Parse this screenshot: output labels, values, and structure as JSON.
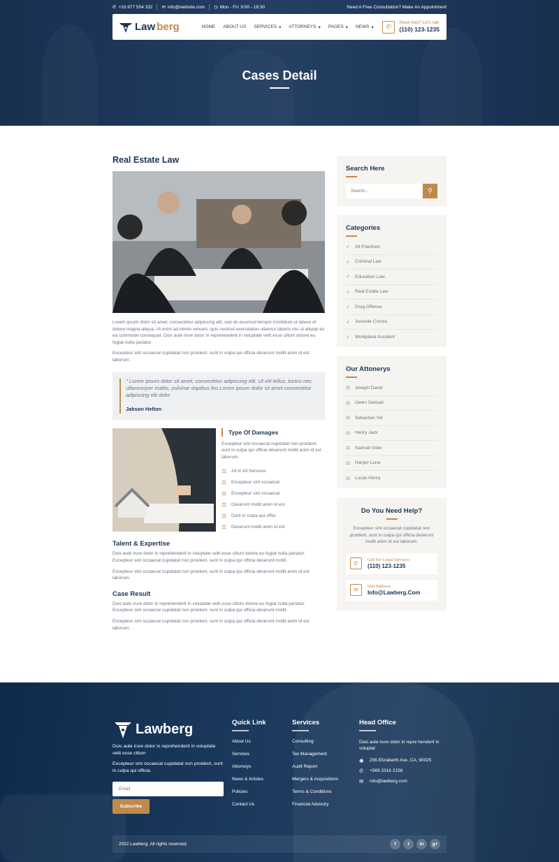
{
  "topbar": {
    "phone": "+33 877 554 332",
    "email": "info@website.com",
    "hours": "Mon - Fri: 9:00 - 18:30",
    "cta": "Need A Free Consultation? Make An Appointment"
  },
  "brand": {
    "name_a": "Law",
    "name_b": "berg",
    "full": "Lawberg"
  },
  "nav": {
    "items": [
      "HOME",
      "ABOUT US",
      "SERVICES",
      "ATTORNEYS",
      "PAGES",
      "NEWS"
    ],
    "help_label": "Need Help? Let's talk",
    "help_phone": "(110) 123-1235"
  },
  "hero": {
    "title": "Cases Detail"
  },
  "article": {
    "title": "Real Estate Law",
    "para1": "Lorem ipsum dolor sit amet, consectetur adipiscing elit, sed do eiusmod tempor incididunt ut labore et dolore magna aliqua. Ut enim ad minim veniam, quis nostrud exercitation ullamco laboris nisi ut aliquip ex ea commodo consequat. Duis aute irure dolor in reprehenderit in voluptate velit esse cillum dolore eu fugiat nulla pariatur.",
    "para2": "Excepteur sint occaecat cupidatat non proident, sunt in culpa qui officia deserunt mollit anim id est laborum.",
    "quote": "\" Lorem ipsum dolor sit amet, consectetur adipiscing elit. Ut elit tellus, luctus nec ullamcorper mattis, pulvinar dapibus leo.Lorem ipsum dolor sit amet consectetur adipiscing elit dolor",
    "quote_author": "Jakson Helton",
    "damages_title": "Type Of Damages",
    "damages_desc": "Excepteur sint occaecat cupidatat non proident, sunt in culpa qui officia deserunt mollit anim id est laborum.",
    "damages_list": [
      "All In All Services",
      "Excepteur sint occaecat",
      "Excepteur sint occaecat",
      "Deserunt mollit anim id est",
      "Dunt in culpa qui offici",
      "Deserunt mollit anim id est"
    ],
    "talent_title": "Talent & Expertise",
    "talent_p1": "Duis aute irure dolor in reprehenderit in voluptate velit esse cillum dolore eu fugiat nulla pariatur. Excepteur sint occaecat cupidatat non proident, sunt in culpa qui officia deserunt mollit.",
    "talent_p2": "Excepteur sint occaecat cupidatat non proident, sunt in culpa qui officia deserunt mollit anim id est laborum.",
    "result_title": "Case Result",
    "result_p1": "Duis aute irure dolor in reprehenderit in voluptate velit esse cillum dolore eu fugiat nulla pariatur. Excepteur sint occaecat cupidatat non proident, sunt in culpa qui officia deserunt mollit.",
    "result_p2": "Excepteur sint occaecat cupidatat non proident, sunt in culpa qui officia deserunt mollit anim id est laborum."
  },
  "sidebar": {
    "search_title": "Search Here",
    "search_placeholder": "Search...",
    "categories_title": "Categories",
    "categories": [
      "All Practises",
      "Criminal Law",
      "Education Law",
      "Real Estate Law",
      "Drug Offense",
      "Juvenile Crimes",
      "Workplace Accident"
    ],
    "attorneys_title": "Our Attonerys",
    "attorneys": [
      "Joseph David",
      "Owen Samuel",
      "Sebastian Vol",
      "Henry Jack",
      "Samuel Voler",
      "Harper Luna",
      "Lucas Henry"
    ],
    "help_title": "Do You Need Help?",
    "help_desc": "Excepteur sint occaecat cupidatat non proident, sunt in culpa qui officia deserunt mollit anim id est laborum.",
    "call_label": "Call For Legal Services",
    "call_value": "(110) 123-1235",
    "mail_label": "Mail Address",
    "mail_value": "Info@Lawberg.Com"
  },
  "footer": {
    "about1": "Duis aute irure dolor in reprehenderit in voluptate velit esse cillum",
    "about2": "Excepteur sint occaecat cupidatat non proident, sunt in culpa qui officia.",
    "email_placeholder": "Email",
    "subscribe": "Subscribe",
    "quick_title": "Quick Link",
    "quick": [
      "About Us",
      "Services",
      "Attorneys",
      "News & Articles",
      "Policies",
      "Contact Us"
    ],
    "services_title": "Services",
    "services": [
      "Consulting",
      "Tax Management",
      "Audit Report",
      "Mergers & Acquisitions",
      "Terms & Conditions",
      "Financial Advisory"
    ],
    "office_title": "Head Office",
    "office_text": "Duis aute irure dolor in repre henderit in voluptat",
    "address": "256 Elizaberth Ave, CA, 90025",
    "phone": "+569 2316 2156",
    "email": "info@lawberg.com",
    "copyright": "2022 Lawberg. All rights reserved.",
    "social": [
      "f",
      "t",
      "in",
      "g+"
    ]
  }
}
